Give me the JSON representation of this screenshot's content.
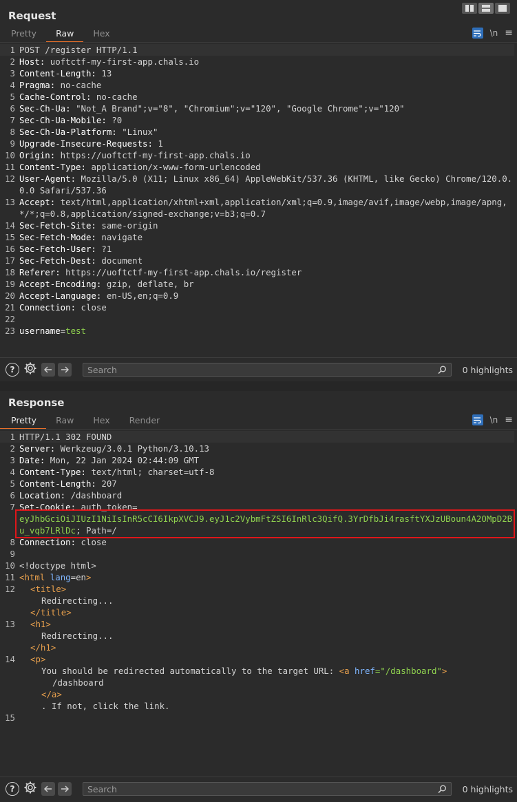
{
  "request": {
    "title": "Request",
    "tabs": [
      "Pretty",
      "Raw",
      "Hex"
    ],
    "wrap_label": "\\n",
    "lines": [
      {
        "n": "1",
        "t": "POST /register HTTP/1.1"
      },
      {
        "n": "2",
        "k": "Host:",
        "v": " uoftctf-my-first-app.chals.io"
      },
      {
        "n": "3",
        "k": "Content-Length:",
        "v": " 13"
      },
      {
        "n": "4",
        "k": "Pragma:",
        "v": " no-cache"
      },
      {
        "n": "5",
        "k": "Cache-Control:",
        "v": " no-cache"
      },
      {
        "n": "6",
        "k": "Sec-Ch-Ua:",
        "v": " \"Not_A Brand\";v=\"8\", \"Chromium\";v=\"120\", \"Google Chrome\";v=\"120\""
      },
      {
        "n": "7",
        "k": "Sec-Ch-Ua-Mobile:",
        "v": " ?0"
      },
      {
        "n": "8",
        "k": "Sec-Ch-Ua-Platform:",
        "v": " \"Linux\""
      },
      {
        "n": "9",
        "k": "Upgrade-Insecure-Requests:",
        "v": " 1"
      },
      {
        "n": "10",
        "k": "Origin:",
        "v": " https://uoftctf-my-first-app.chals.io"
      },
      {
        "n": "11",
        "k": "Content-Type:",
        "v": " application/x-www-form-urlencoded"
      },
      {
        "n": "12",
        "k": "User-Agent:",
        "v": " Mozilla/5.0 (X11; Linux x86_64) AppleWebKit/537.36 (KHTML, like Gecko) Chrome/120.0.0.0 Safari/537.36"
      },
      {
        "n": "13",
        "k": "Accept:",
        "v": " text/html,application/xhtml+xml,application/xml;q=0.9,image/avif,image/webp,image/apng,*/*;q=0.8,application/signed-exchange;v=b3;q=0.7"
      },
      {
        "n": "14",
        "k": "Sec-Fetch-Site:",
        "v": " same-origin"
      },
      {
        "n": "15",
        "k": "Sec-Fetch-Mode:",
        "v": " navigate"
      },
      {
        "n": "16",
        "k": "Sec-Fetch-User:",
        "v": " ?1"
      },
      {
        "n": "17",
        "k": "Sec-Fetch-Dest:",
        "v": " document"
      },
      {
        "n": "18",
        "k": "Referer:",
        "v": " https://uoftctf-my-first-app.chals.io/register"
      },
      {
        "n": "19",
        "k": "Accept-Encoding:",
        "v": " gzip, deflate, br"
      },
      {
        "n": "20",
        "k": "Accept-Language:",
        "v": " en-US,en;q=0.9"
      },
      {
        "n": "21",
        "k": "Connection:",
        "v": " close"
      },
      {
        "n": "22",
        "t": ""
      },
      {
        "n": "23",
        "k": "username=",
        "v": "test",
        "green": true
      }
    ],
    "search_placeholder": "Search",
    "highlights": "0 highlights"
  },
  "response": {
    "title": "Response",
    "tabs": [
      "Pretty",
      "Raw",
      "Hex",
      "Render"
    ],
    "wrap_label": "\\n",
    "status_line": "HTTP/1.1 302 FOUND",
    "headers": [
      {
        "n": "2",
        "k": "Server:",
        "v": " Werkzeug/3.0.1 Python/3.10.13"
      },
      {
        "n": "3",
        "k": "Date:",
        "v": " Mon, 22 Jan 2024 02:44:09 GMT"
      },
      {
        "n": "4",
        "k": "Content-Type:",
        "v": " text/html; charset=utf-8"
      },
      {
        "n": "5",
        "k": "Content-Length:",
        "v": " 207"
      },
      {
        "n": "6",
        "k": "Location:",
        "v": " /dashboard"
      }
    ],
    "cookie_key": "Set-Cookie:",
    "cookie_name": " auth_token=",
    "cookie_value": "eyJhbGciOiJIUzI1NiIsInR5cCI6IkpXVCJ9.eyJ1c2VybmFtZSI6InRlc3QifQ.3YrDfbJi4rasftYXJzUBoun4A2OMpD2Bu_vqb7LRlDc",
    "cookie_tail": "; Path=/",
    "connection": {
      "n": "8",
      "k": "Connection:",
      "v": " close"
    },
    "body": {
      "doctype": "<!doctype html>",
      "html_open": "<html",
      "html_attr": " lang",
      "html_val": "=en",
      "html_close": ">",
      "title_open": "<title>",
      "title_text": "Redirecting...",
      "title_close": "</title>",
      "h1_open": "<h1>",
      "h1_text": "Redirecting...",
      "h1_close": "</h1>",
      "p_open": "<p>",
      "p_text": "You should be redirected automatically to the target URL: ",
      "a_open": "<a",
      "a_attr": " href",
      "a_val": "=\"/dashboard\"",
      "a_gt": ">",
      "a_text": "/dashboard",
      "a_close": "</a>",
      "tail_text": ". If not, click the link."
    },
    "search_placeholder": "Search",
    "highlights": "0 highlights"
  },
  "colors": {
    "accent": "#e8702a",
    "highlight_box": "#e0161a",
    "cookie_green": "#8fd14f"
  }
}
